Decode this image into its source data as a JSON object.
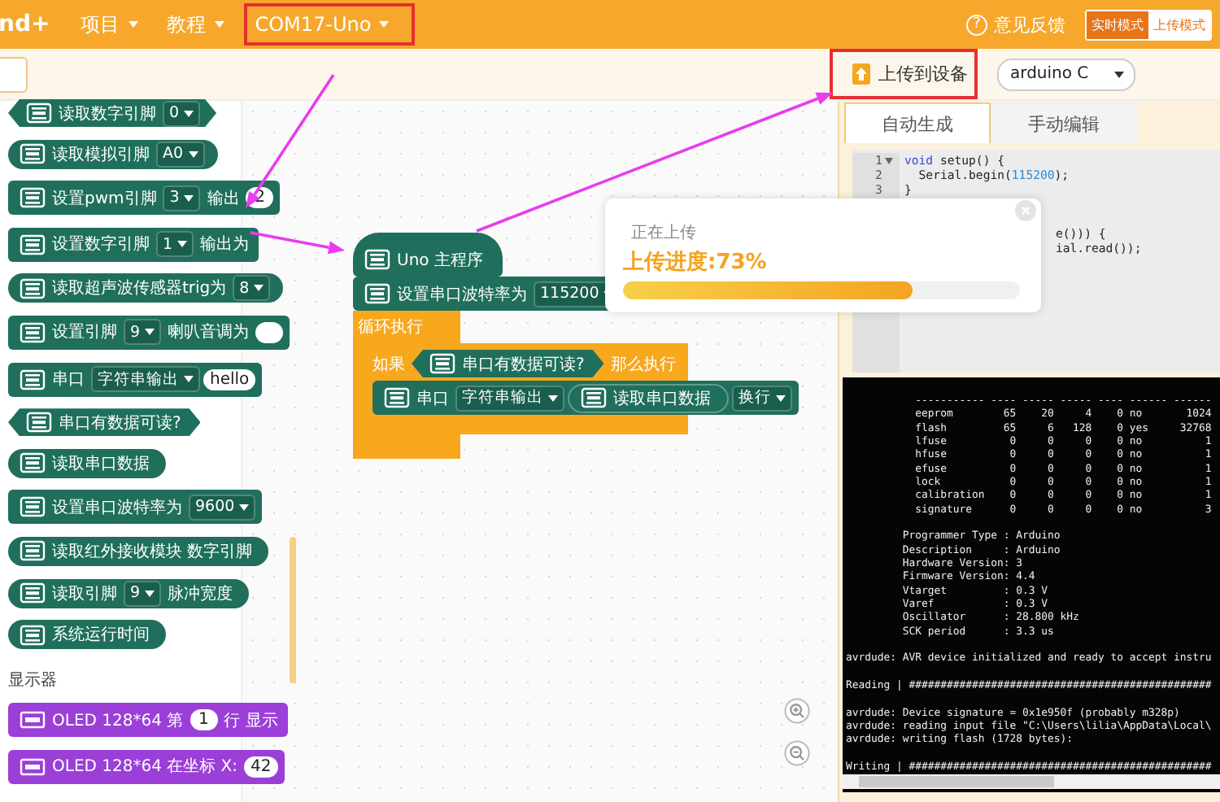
{
  "top_bar": {
    "logo": "nd+",
    "menus": [
      {
        "label": "项目",
        "highlighted": false
      },
      {
        "label": "教程",
        "highlighted": false
      },
      {
        "label": "COM17-Uno",
        "highlighted": true
      }
    ],
    "help": "?",
    "feedback": "意见反馈",
    "modes": [
      {
        "label": "实时模式",
        "selected": false
      },
      {
        "label": "上传模式",
        "selected": true
      }
    ]
  },
  "toolbar": {
    "upload_button": {
      "label": "上传到设备",
      "highlighted": true
    },
    "language_select": {
      "value": "arduino C"
    }
  },
  "palette": {
    "items": [
      {
        "kind": "boolean",
        "color": "#1f6f5c",
        "parts": [
          {
            "kind": "label",
            "text": "读取数字引脚"
          },
          {
            "kind": "dropdown",
            "text": "0"
          }
        ]
      },
      {
        "kind": "reporter",
        "color": "#1f6f5c",
        "parts": [
          {
            "kind": "label",
            "text": "读取模拟引脚"
          },
          {
            "kind": "dropdown",
            "text": "A0"
          }
        ]
      },
      {
        "kind": "statement",
        "color": "#1f6f5c",
        "parts": [
          {
            "kind": "label",
            "text": "设置pwm引脚"
          },
          {
            "kind": "dropdown",
            "text": "3"
          },
          {
            "kind": "label",
            "text": "输出"
          },
          {
            "kind": "input",
            "text": "2"
          }
        ]
      },
      {
        "kind": "statement",
        "color": "#1f6f5c",
        "parts": [
          {
            "kind": "label",
            "text": "设置数字引脚"
          },
          {
            "kind": "dropdown",
            "text": "1"
          },
          {
            "kind": "label",
            "text": "输出为"
          }
        ]
      },
      {
        "kind": "reporter",
        "color": "#1f6f5c",
        "parts": [
          {
            "kind": "label",
            "text": "读取超声波传感器trig为"
          },
          {
            "kind": "dropdown",
            "text": "8"
          }
        ]
      },
      {
        "kind": "statement",
        "color": "#1f6f5c",
        "parts": [
          {
            "kind": "label",
            "text": "设置引脚"
          },
          {
            "kind": "dropdown",
            "text": "9"
          },
          {
            "kind": "label",
            "text": "喇叭音调为"
          },
          {
            "kind": "input"
          }
        ]
      },
      {
        "kind": "statement",
        "color": "#1f6f5c",
        "parts": [
          {
            "kind": "label",
            "text": "串口"
          },
          {
            "kind": "dropdown",
            "text": "字符串输出"
          },
          {
            "kind": "input",
            "text": "hello"
          }
        ]
      },
      {
        "kind": "boolean",
        "color": "#1f6f5c",
        "parts": [
          {
            "kind": "label",
            "text": "串口有数据可读?"
          }
        ]
      },
      {
        "kind": "reporter",
        "color": "#1f6f5c",
        "parts": [
          {
            "kind": "label",
            "text": "读取串口数据"
          }
        ]
      },
      {
        "kind": "statement",
        "color": "#1f6f5c",
        "parts": [
          {
            "kind": "label",
            "text": "设置串口波特率为"
          },
          {
            "kind": "dropdown",
            "text": "9600"
          }
        ]
      },
      {
        "kind": "reporter",
        "color": "#1f6f5c",
        "parts": [
          {
            "kind": "label",
            "text": "读取红外接收模块 数字引脚"
          }
        ]
      },
      {
        "kind": "reporter",
        "color": "#1f6f5c",
        "parts": [
          {
            "kind": "label",
            "text": "读取引脚"
          },
          {
            "kind": "dropdown",
            "text": "9"
          },
          {
            "kind": "label",
            "text": "脉冲宽度"
          }
        ]
      },
      {
        "kind": "reporter",
        "color": "#1f6f5c",
        "parts": [
          {
            "kind": "label",
            "text": "系统运行时间"
          }
        ]
      },
      {
        "kind": "heading",
        "text": "显示器"
      },
      {
        "kind": "statement",
        "color": "#9b3fd8",
        "parts": [
          {
            "kind": "label",
            "text": "OLED 128*64 第"
          },
          {
            "kind": "input",
            "text": "1"
          },
          {
            "kind": "label",
            "text": "行 显示"
          }
        ]
      },
      {
        "kind": "statement",
        "color": "#9b3fd8",
        "parts": [
          {
            "kind": "label",
            "text": "OLED 128*64 在坐标 X:"
          },
          {
            "kind": "input",
            "text": "42"
          }
        ]
      }
    ]
  },
  "canvas": {
    "script": {
      "hat": {
        "kind": "hat",
        "color": "#1f6f5c",
        "parts": [
          {
            "kind": "label",
            "text": "Uno 主程序"
          }
        ]
      },
      "setup": [
        {
          "kind": "statement",
          "color": "#1f6f5c",
          "parts": [
            {
              "kind": "label",
              "text": "设置串口波特率为"
            },
            {
              "kind": "dropdown",
              "text": "115200"
            }
          ]
        }
      ],
      "loop": {
        "label": "循环执行",
        "body": [
          {
            "kind": "if",
            "label_if": "如果",
            "condition": {
              "kind": "boolean",
              "color": "#1f6f5c",
              "parts": [
                {
                  "kind": "label",
                  "text": "串口有数据可读?"
                }
              ]
            },
            "label_then": "那么执行",
            "body": [
              {
                "kind": "statement",
                "color": "#1f6f5c",
                "parts": [
                  {
                    "kind": "label",
                    "text": "串口"
                  },
                  {
                    "kind": "dropdown",
                    "text": "字符串输出"
                  },
                  {
                    "kind": "block",
                    "block": {
                      "kind": "reporter",
                      "color": "#1f6f5c",
                      "parts": [
                        {
                          "kind": "label",
                          "text": "读取串口数据"
                        }
                      ]
                    }
                  },
                  {
                    "kind": "dropdown",
                    "text": "换行"
                  }
                ]
              }
            ]
          }
        ]
      }
    }
  },
  "upload_popup": {
    "title": "正在上传",
    "progress_label": "上传进度:73%",
    "level": 0.73
  },
  "code_panel": {
    "tabs": [
      {
        "label": "自动生成",
        "selected": true
      },
      {
        "label": "手动编辑",
        "selected": false
      }
    ],
    "code": {
      "lines": [
        {
          "number": "1",
          "expanded": true,
          "tokens": [
            {
              "kind": "keyword",
              "text": "void"
            },
            {
              "kind": "plain",
              "text": " setup() {"
            }
          ]
        },
        {
          "number": "2",
          "tokens": [
            {
              "kind": "plain",
              "text": "  Serial.begin("
            },
            {
              "kind": "number",
              "text": "115200"
            },
            {
              "kind": "plain",
              "text": ");"
            }
          ]
        },
        {
          "number": "3",
          "tokens": [
            {
              "kind": "plain",
              "text": "}"
            }
          ]
        }
      ],
      "fragments": [
        "e())) {",
        "ial.read());"
      ]
    },
    "console": {
      "lines": [
        {
          "text": "           ----------- ---- ----- ----- ---- ------ ------"
        },
        {
          "text": "           eeprom        65    20     4    0 no       1024"
        },
        {
          "text": "           flash         65     6   128    0 yes     32768"
        },
        {
          "text": "           lfuse          0     0     0    0 no          1"
        },
        {
          "text": "           hfuse          0     0     0    0 no          1"
        },
        {
          "text": "           efuse          0     0     0    0 no          1"
        },
        {
          "text": "           lock           0     0     0    0 no          1"
        },
        {
          "text": "           calibration    0     0     0    0 no          1"
        },
        {
          "text": "           signature      0     0     0    0 no          3"
        },
        {
          "text": "         Programmer Type : Arduino",
          "gap": true
        },
        {
          "text": "         Description     : Arduino"
        },
        {
          "text": "         Hardware Version: 3"
        },
        {
          "text": "         Firmware Version: 4.4"
        },
        {
          "text": "         Vtarget         : 0.3 V"
        },
        {
          "text": "         Varef           : 0.3 V"
        },
        {
          "text": "         Oscillator      : 28.800 kHz"
        },
        {
          "text": "         SCK period      : 3.3 us"
        },
        {
          "text": "avrdude: AVR device initialized and ready to accept instru",
          "gap": true
        },
        {
          "text": "Reading | ################################################",
          "gap": true
        },
        {
          "text": "avrdude: Device signature = 0x1e950f (probably m328p)",
          "gap": true
        },
        {
          "text": "avrdude: reading input file \"C:\\Users\\lilia\\AppData\\Local\\"
        },
        {
          "text": "avrdude: writing flash (1728 bytes):"
        },
        {
          "text": "Writing | ################################################",
          "gap": true
        }
      ]
    }
  }
}
